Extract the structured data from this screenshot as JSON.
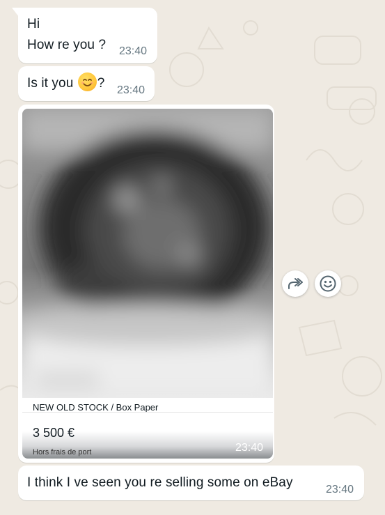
{
  "messages": {
    "m1": {
      "line1": "Hi",
      "line2": "How re you ?",
      "time": "23:40"
    },
    "m2": {
      "text_before": "Is it you",
      "emoji": "smiling-face",
      "text_after": "?",
      "time": "23:40"
    },
    "m3": {
      "image_alt": "blurred product photo",
      "caption": "NEW OLD STOCK / Box Paper",
      "price": "3 500 €",
      "shipping": "Hors frais de port",
      "time": "23:40"
    },
    "m4": {
      "text": "I think I ve seen you re selling some on eBay",
      "time": "23:40"
    }
  },
  "actions": {
    "forward": "forward-icon",
    "react": "emoji-react-icon"
  },
  "colors": {
    "chat_bg": "#efeae2",
    "bubble": "#ffffff",
    "meta": "#667781"
  }
}
